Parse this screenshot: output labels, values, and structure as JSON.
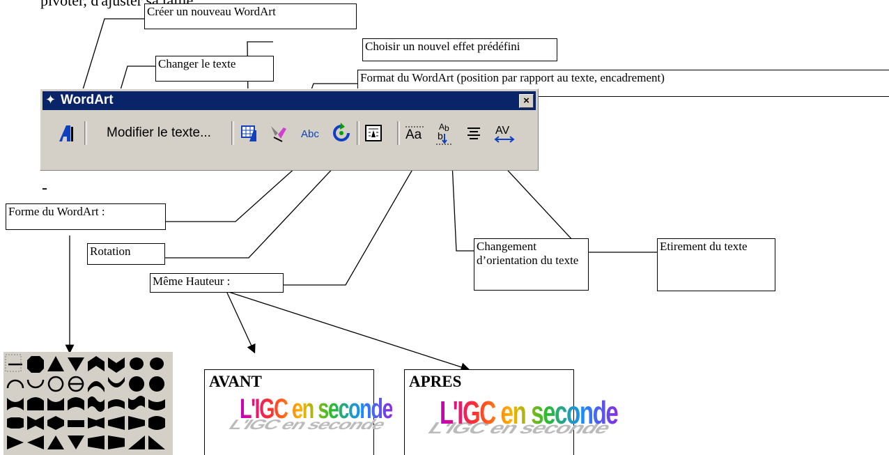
{
  "top_text": "pivoter, d'ajuster sa taille…",
  "callouts": {
    "nouveau": "Créer un nouveau WordArt",
    "effet": "Choisir un nouvel effet prédéfini",
    "changer": "Changer le texte",
    "format": "Format du WordArt (position par rapport au texte, encadrement)",
    "forme": "Forme du WordArt :",
    "rotation": "Rotation",
    "hauteur": "Même Hauteur :",
    "orientation": "Changement d’orientation du texte",
    "etirement": "Etirement du texte"
  },
  "dash": "-",
  "toolbar": {
    "title": "WordArt",
    "close": "×",
    "modify_label": "Modifier le texte...",
    "tools": [
      "insert-wordart-icon",
      "gallery-icon",
      "format-wordart-icon",
      "shape-icon",
      "rotate-icon",
      "text-wrap-icon",
      "same-height-icon",
      "vertical-text-icon",
      "alignment-icon",
      "character-spacing-icon"
    ]
  },
  "examples": {
    "avant": {
      "title": "AVANT",
      "art": "L'IGC en seconde"
    },
    "apres": {
      "title": "APRES",
      "art": "L'IGC en seconde"
    }
  },
  "palette_shapes": 40
}
